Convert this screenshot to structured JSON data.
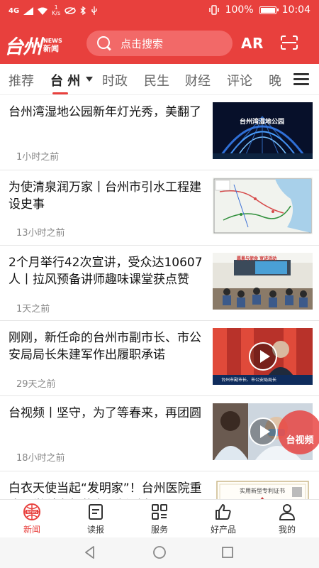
{
  "status_bar": {
    "signal_label": "4G",
    "speed": "1",
    "speed_unit": "K/s",
    "battery_percent": "100%",
    "battery_level": 1.0,
    "time": "10:04"
  },
  "header": {
    "logo_cn": "台州",
    "logo_en": "NEWS",
    "logo_sub": "新闻",
    "search_placeholder": "点击搜索",
    "ar_label": "AR",
    "brand_color": "#e8403d"
  },
  "tabs": [
    "推荐",
    "台 州",
    "时政",
    "民生",
    "财经",
    "评论",
    "晚"
  ],
  "active_tab": "台 州",
  "news": [
    {
      "title": "台州湾湿地公园新年灯光秀，美翻了",
      "time": "1小时之前",
      "thumb_text": "台州湾湿地公园"
    },
    {
      "title": "为使清泉润万家丨台州市引水工程建设史事",
      "time": "13小时之前"
    },
    {
      "title": "2个月举行42次宣讲，受众达10607人丨拉风预备讲师趣味课堂获点赞",
      "time": "1天之前",
      "thumb_text": "愿景与使命 宣讲活动"
    },
    {
      "title": "刚刚，新任命的台州市副市长、市公安局局长朱建军作出履职承诺",
      "time": "29天之前",
      "thumb_text": "台州市副市长、市公安局局长"
    },
    {
      "title": "台视频丨坚守，为了等春来，再团圆",
      "time": "18小时之前"
    },
    {
      "title": "白衣天使当起“发明家”！台州医院重症医学科去年获实用新型专",
      "time": "",
      "thumb_text": "实用新型专利证书"
    }
  ],
  "float_badge": "台视频",
  "bottom_nav": [
    {
      "label": "新闻",
      "icon": "news-icon"
    },
    {
      "label": "读报",
      "icon": "newspaper-icon"
    },
    {
      "label": "服务",
      "icon": "grid-icon"
    },
    {
      "label": "好产品",
      "icon": "thumbs-up-icon"
    },
    {
      "label": "我的",
      "icon": "user-icon"
    }
  ],
  "active_nav": "新闻"
}
